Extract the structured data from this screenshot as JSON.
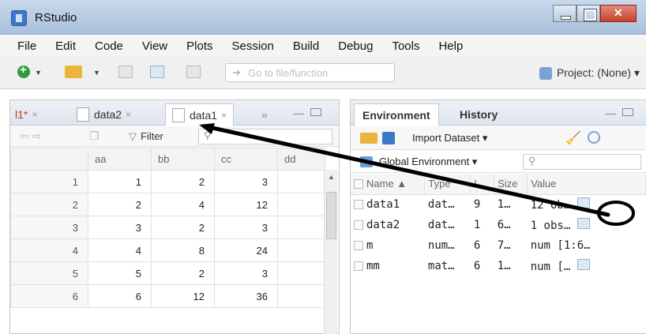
{
  "window": {
    "title": "RStudio"
  },
  "menu": [
    "File",
    "Edit",
    "Code",
    "View",
    "Plots",
    "Session",
    "Build",
    "Debug",
    "Tools",
    "Help"
  ],
  "toolbar": {
    "goto_placeholder": "Go to file/function",
    "project_label": "Project: (None) ▾"
  },
  "source_pane": {
    "tabs": [
      {
        "label": "l1*",
        "modified": true
      },
      {
        "label": "data2"
      },
      {
        "label": "data1",
        "active": true
      }
    ],
    "more": "»",
    "filter_label": "Filter",
    "search_glyph": "🔍",
    "columns": [
      "",
      "aa",
      "bb",
      "cc",
      "dd"
    ],
    "rows": [
      [
        "1",
        "1",
        "2",
        "3",
        ""
      ],
      [
        "2",
        "2",
        "4",
        "12",
        ""
      ],
      [
        "3",
        "3",
        "2",
        "3",
        ""
      ],
      [
        "4",
        "4",
        "8",
        "24",
        ""
      ],
      [
        "5",
        "5",
        "2",
        "3",
        ""
      ],
      [
        "6",
        "6",
        "12",
        "36",
        ""
      ]
    ]
  },
  "env_pane": {
    "tabs": [
      "Environment",
      "History"
    ],
    "import_label": "Import Dataset ▾",
    "scope_label": "Global Environment ▾",
    "columns": [
      "Name ▲",
      "Type",
      "L",
      "Size",
      "Value"
    ],
    "rows": [
      {
        "name": "data1",
        "type": "dat…",
        "length": "9",
        "size": "1…",
        "value": "12 ob…"
      },
      {
        "name": "data2",
        "type": "dat…",
        "length": "1",
        "size": "6…",
        "value": "1 obs…"
      },
      {
        "name": "m",
        "type": "num…",
        "length": "6",
        "size": "7…",
        "value": "num [1:6…"
      },
      {
        "name": "mm",
        "type": "mat…",
        "length": "6",
        "size": "1…",
        "value": "num […"
      }
    ]
  },
  "colors": {
    "accent": "#3b78c9",
    "annotation": "#000000"
  }
}
